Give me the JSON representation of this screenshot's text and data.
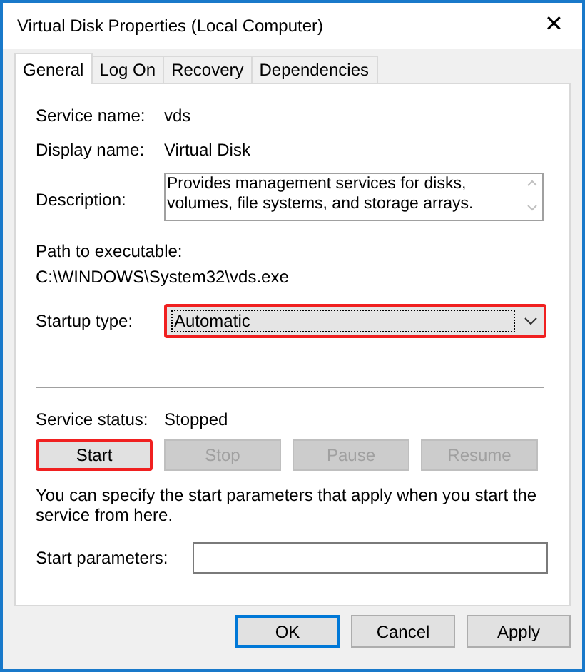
{
  "window": {
    "title": "Virtual Disk Properties (Local Computer)",
    "close": "✕"
  },
  "tabs": [
    {
      "label": "General",
      "selected": true
    },
    {
      "label": "Log On",
      "selected": false
    },
    {
      "label": "Recovery",
      "selected": false
    },
    {
      "label": "Dependencies",
      "selected": false
    }
  ],
  "fields": [
    {
      "label": "Service name:",
      "value": "vds"
    },
    {
      "label": "Display name:",
      "value": "Virtual Disk"
    }
  ],
  "description": {
    "label": "Description:",
    "value": "Provides management services for disks, volumes, file systems, and storage arrays."
  },
  "path": {
    "label": "Path to executable:",
    "value": "C:\\WINDOWS\\System32\\vds.exe"
  },
  "startup_type": {
    "label": "Startup type:",
    "value": "Automatic",
    "highlighted": true
  },
  "service_status": {
    "label": "Service status:",
    "value": "Stopped"
  },
  "service_buttons": [
    {
      "label": "Start",
      "disabled": false,
      "highlighted": true
    },
    {
      "label": "Stop",
      "disabled": true,
      "highlighted": false
    },
    {
      "label": "Pause",
      "disabled": true,
      "highlighted": false
    },
    {
      "label": "Resume",
      "disabled": true,
      "highlighted": false
    }
  ],
  "hint": "You can specify the start parameters that apply when you start the service from here.",
  "start_parameters": {
    "label": "Start parameters:"
  },
  "dialog_buttons": [
    {
      "label": "OK",
      "default": true
    },
    {
      "label": "Cancel",
      "default": false
    },
    {
      "label": "Apply",
      "default": false
    }
  ]
}
